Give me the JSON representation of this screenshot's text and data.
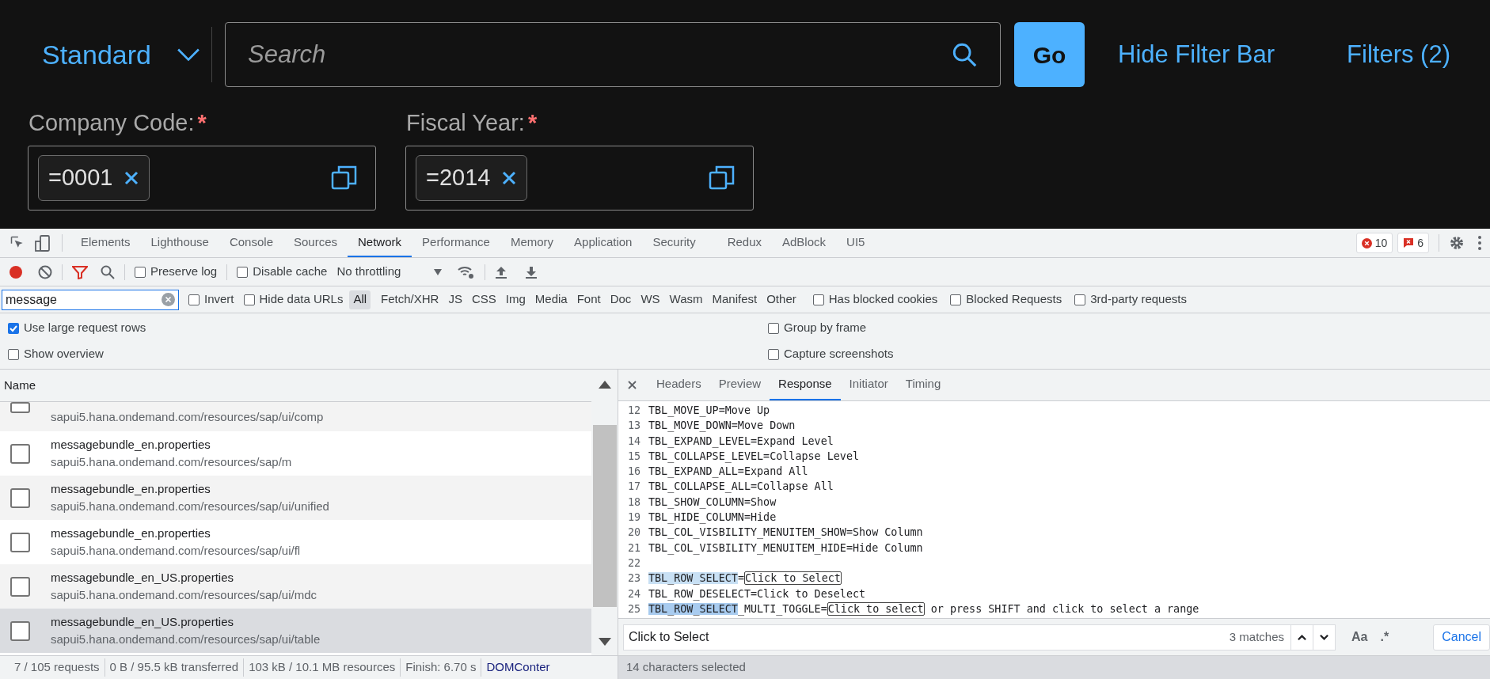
{
  "filter_bar": {
    "variant": "Standard",
    "search": {
      "placeholder": "Search"
    },
    "go_button": "Go",
    "hide_filter_bar": "Hide Filter Bar",
    "filters": "Filters (2)",
    "fields": [
      {
        "label": "Company Code:",
        "required": "*",
        "token": "=0001"
      },
      {
        "label": "Fiscal Year:",
        "required": "*",
        "token": "=2014"
      }
    ]
  },
  "devtools": {
    "tabs": [
      {
        "label": "Elements",
        "selected": false
      },
      {
        "label": "Lighthouse",
        "selected": false
      },
      {
        "label": "Console",
        "selected": false
      },
      {
        "label": "Sources",
        "selected": false
      },
      {
        "label": "Network",
        "selected": true
      },
      {
        "label": "Performance",
        "selected": false
      },
      {
        "label": "Memory",
        "selected": false
      },
      {
        "label": "Application",
        "selected": false
      },
      {
        "label": "Security",
        "selected": false
      },
      {
        "label": "Redux",
        "selected": false
      },
      {
        "label": "AdBlock",
        "selected": false
      },
      {
        "label": "UI5",
        "selected": false
      }
    ],
    "errors": "10",
    "issues": "6",
    "toolbar": {
      "recording": true,
      "filter_active": true,
      "preserve_log": {
        "label": "Preserve log",
        "checked": false
      },
      "disable_cache": {
        "label": "Disable cache",
        "checked": false
      },
      "throttling": "No throttling"
    },
    "filter": {
      "value": "message",
      "invert": {
        "label": "Invert",
        "checked": false
      },
      "hide_data_urls": {
        "label": "Hide data URLs",
        "checked": false
      },
      "types": [
        {
          "label": "All",
          "selected": true
        },
        {
          "label": "Fetch/XHR",
          "selected": false
        },
        {
          "label": "JS",
          "selected": false
        },
        {
          "label": "CSS",
          "selected": false
        },
        {
          "label": "Img",
          "selected": false
        },
        {
          "label": "Media",
          "selected": false
        },
        {
          "label": "Font",
          "selected": false
        },
        {
          "label": "Doc",
          "selected": false
        },
        {
          "label": "WS",
          "selected": false
        },
        {
          "label": "Wasm",
          "selected": false
        },
        {
          "label": "Manifest",
          "selected": false
        },
        {
          "label": "Other",
          "selected": false
        }
      ],
      "checks": [
        {
          "label": "Has blocked cookies",
          "checked": false
        },
        {
          "label": "Blocked Requests",
          "checked": false
        },
        {
          "label": "3rd-party requests",
          "checked": false
        }
      ]
    },
    "options_left": [
      {
        "label": "Use large request rows",
        "checked": true
      },
      {
        "label": "Show overview",
        "checked": false
      }
    ],
    "options_right": [
      {
        "label": "Group by frame",
        "checked": false
      },
      {
        "label": "Capture screenshots",
        "checked": false
      }
    ],
    "requests": {
      "column": "Name",
      "rows": [
        {
          "url": "sapui5.hana.ondemand.com/resources/sap/ui/comp",
          "selected": false
        },
        {
          "name": "messagebundle_en.properties",
          "url": "sapui5.hana.ondemand.com/resources/sap/m",
          "selected": false
        },
        {
          "name": "messagebundle_en.properties",
          "url": "sapui5.hana.ondemand.com/resources/sap/ui/unified",
          "selected": false
        },
        {
          "name": "messagebundle_en.properties",
          "url": "sapui5.hana.ondemand.com/resources/sap/ui/fl",
          "selected": false
        },
        {
          "name": "messagebundle_en_US.properties",
          "url": "sapui5.hana.ondemand.com/resources/sap/ui/mdc",
          "selected": false
        },
        {
          "name": "messagebundle_en_US.properties",
          "url": "sapui5.hana.ondemand.com/resources/sap/ui/table",
          "selected": true
        }
      ]
    },
    "detail_tabs": [
      {
        "label": "Headers",
        "selected": false
      },
      {
        "label": "Preview",
        "selected": false
      },
      {
        "label": "Response",
        "selected": true
      },
      {
        "label": "Initiator",
        "selected": false
      },
      {
        "label": "Timing",
        "selected": false
      }
    ],
    "response_lines": [
      {
        "number": "12",
        "parts": [
          {
            "kind": "plain",
            "text": "TBL_MOVE_UP=Move Up"
          }
        ]
      },
      {
        "number": "13",
        "parts": [
          {
            "kind": "plain",
            "text": "TBL_MOVE_DOWN=Move Down"
          }
        ]
      },
      {
        "number": "14",
        "parts": [
          {
            "kind": "plain",
            "text": "TBL_EXPAND_LEVEL=Expand Level"
          }
        ]
      },
      {
        "number": "15",
        "parts": [
          {
            "kind": "plain",
            "text": "TBL_COLLAPSE_LEVEL=Collapse Level"
          }
        ]
      },
      {
        "number": "16",
        "parts": [
          {
            "kind": "plain",
            "text": "TBL_EXPAND_ALL=Expand All"
          }
        ]
      },
      {
        "number": "17",
        "parts": [
          {
            "kind": "plain",
            "text": "TBL_COLLAPSE_ALL=Collapse All"
          }
        ]
      },
      {
        "number": "18",
        "parts": [
          {
            "kind": "plain",
            "text": "TBL_SHOW_COLUMN=Show"
          }
        ]
      },
      {
        "number": "19",
        "parts": [
          {
            "kind": "plain",
            "text": "TBL_HIDE_COLUMN=Hide"
          }
        ]
      },
      {
        "number": "20",
        "parts": [
          {
            "kind": "plain",
            "text": "TBL_COL_VISBILITY_MENUITEM_SHOW=Show Column"
          }
        ]
      },
      {
        "number": "21",
        "parts": [
          {
            "kind": "plain",
            "text": "TBL_COL_VISBILITY_MENUITEM_HIDE=Hide Column"
          }
        ]
      },
      {
        "number": "22"
      },
      {
        "number": "23",
        "parts": [
          {
            "kind": "match",
            "text": "TBL_ROW_SELECT"
          },
          {
            "kind": "plain",
            "text": "="
          },
          {
            "kind": "boxed",
            "text": "Click to Select"
          }
        ]
      },
      {
        "number": "24",
        "parts": [
          {
            "kind": "plain",
            "text": "TBL_ROW_DESELECT=Click to Deselect"
          }
        ]
      },
      {
        "number": "25",
        "parts": [
          {
            "kind": "current_match",
            "text": "TBL_ROW_SELECT"
          },
          {
            "kind": "plain",
            "text": "_MULTI_TOGGLE="
          },
          {
            "kind": "boxed",
            "text": "Click to select"
          },
          {
            "kind": "plain",
            "text": " or press SHIFT and click to select a range"
          }
        ]
      }
    ],
    "find": {
      "value": "Click to Select",
      "matches": "3 matches",
      "case": "Aa",
      "regex": ".*",
      "cancel": "Cancel"
    },
    "status_left": [
      "7 / 105 requests",
      "0 B / 95.5 kB transferred",
      "103 kB / 10.1 MB resources",
      "Finish: 6.70 s"
    ],
    "status_link": "DOMConter",
    "status_right": "14 characters selected"
  }
}
